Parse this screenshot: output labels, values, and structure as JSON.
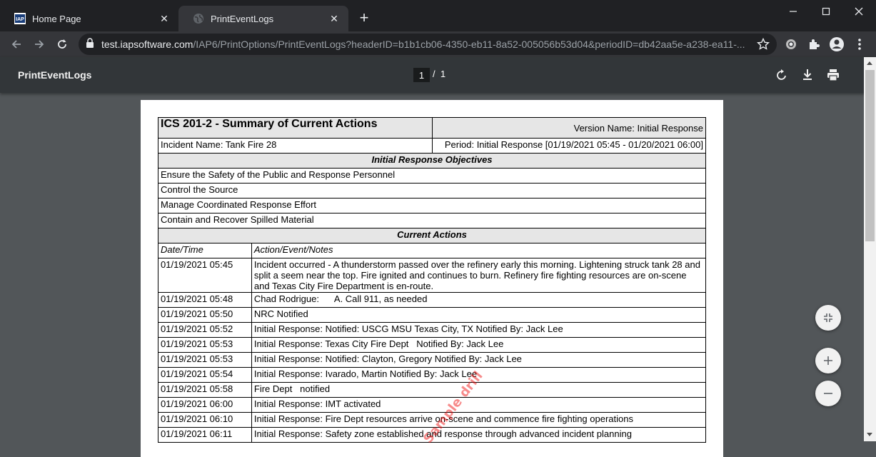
{
  "browser": {
    "tabs": [
      {
        "title": "Home Page",
        "favicon": "iap-logo-icon",
        "active": false
      },
      {
        "title": "PrintEventLogs",
        "favicon": "globe-icon",
        "active": true
      }
    ],
    "url_host": "test.iapsoftware.com",
    "url_path": "/IAP6/PrintOptions/PrintEventLogs?headerID=b1b1cb06-4350-eb11-8a52-005056b53d04&periodID=db42aa5e-a238-ea11-..."
  },
  "pdf_viewer": {
    "title": "PrintEventLogs",
    "current_page": "1",
    "page_separator": "/",
    "total_pages": "1"
  },
  "document": {
    "form_title": "ICS 201-2 - Summary of Current Actions",
    "version_name": "Version Name: Initial Response",
    "incident_name": "Incident Name: Tank Fire 28",
    "period": "Period: Initial Response [01/19/2021 05:45 - 01/20/2021 06:00]",
    "objectives_header": "Initial Response Objectives",
    "objectives": [
      "Ensure the Safety of the Public and Response Personnel",
      "Control the Source",
      "Manage Coordinated Response Effort",
      "Contain and Recover Spilled Material"
    ],
    "actions_header": "Current Actions",
    "col_datetime": "Date/Time",
    "col_action": "Action/Event/Notes",
    "actions": [
      {
        "datetime": "01/19/2021 05:45",
        "note": "Incident occurred - A thunderstorm passed over the refinery early this morning. Lightening struck tank 28 and split a seem near the top. Fire ignited and continues to burn. Refinery fire fighting resources are on-scene and Texas City Fire Department is en-route."
      },
      {
        "datetime": "01/19/2021 05:48",
        "note": "Chad Rodrigue:      A. Call 911, as needed"
      },
      {
        "datetime": "01/19/2021 05:50",
        "note": "NRC Notified"
      },
      {
        "datetime": "01/19/2021 05:52",
        "note": "Initial Response: Notified: USCG MSU Texas City, TX Notified By: Jack Lee"
      },
      {
        "datetime": "01/19/2021 05:53",
        "note": "Initial Response: Texas City Fire Dept   Notified By: Jack Lee"
      },
      {
        "datetime": "01/19/2021 05:53",
        "note": "Initial Response: Notified: Clayton, Gregory Notified By: Jack Lee"
      },
      {
        "datetime": "01/19/2021 05:54",
        "note": "Initial Response: Ivarado, Martin Notified By: Jack Lee"
      },
      {
        "datetime": "01/19/2021 05:58",
        "note": "Fire Dept   notified"
      },
      {
        "datetime": "01/19/2021 06:00",
        "note": "Initial Response: IMT activated"
      },
      {
        "datetime": "01/19/2021 06:10",
        "note": "Initial Response: Fire Dept resources arrive on-scene and commence fire fighting operations"
      },
      {
        "datetime": "01/19/2021 06:11",
        "note": "Initial Response: Safety zone established and response through advanced incident planning"
      }
    ],
    "watermark": "Sample drill"
  }
}
